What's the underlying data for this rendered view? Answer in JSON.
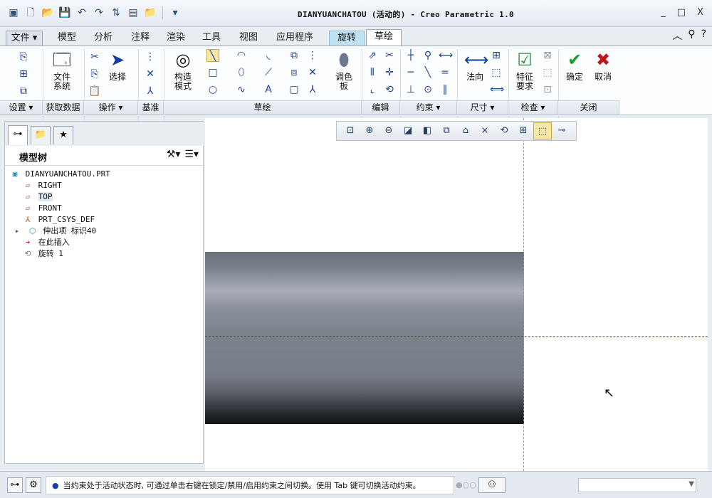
{
  "window": {
    "title": "DIANYUANCHATOU (活动的) - Creo Parametric 1.0",
    "buttons": [
      "_",
      "□",
      "X"
    ]
  },
  "quick_access": [
    "app-logo-icon",
    "new-icon",
    "open-icon",
    "save-icon",
    "undo-icon",
    "redo-icon",
    "regenerate-icon",
    "windows-icon",
    "folder-icon",
    "customize-icon"
  ],
  "tabs": [
    {
      "label": "文件 ▾",
      "kind": "file"
    },
    {
      "label": "模型",
      "kind": "plain"
    },
    {
      "label": "分析",
      "kind": "plain"
    },
    {
      "label": "注释",
      "kind": "plain"
    },
    {
      "label": "渲染",
      "kind": "plain"
    },
    {
      "label": "工具",
      "kind": "plain"
    },
    {
      "label": "视图",
      "kind": "plain"
    },
    {
      "label": "应用程序",
      "kind": "plain"
    },
    {
      "label": "旋转",
      "kind": "rot"
    },
    {
      "label": "草绘",
      "kind": "sk"
    }
  ],
  "ribbon": {
    "big_buttons": {
      "file_system": "文件\n系统",
      "select": "选择",
      "construction_mode": "构造\n模式",
      "palette": "调色\n板",
      "normal": "法向",
      "feature_req": "特征\n要求",
      "ok": "确定",
      "cancel": "取消"
    },
    "groups": [
      {
        "label": "设置 ▾"
      },
      {
        "label": "获取数据"
      },
      {
        "label": "操作 ▾"
      },
      {
        "label": "基准"
      },
      {
        "label": "草绘"
      },
      {
        "label": "编辑"
      },
      {
        "label": "约束 ▾"
      },
      {
        "label": "尺寸 ▾"
      },
      {
        "label": "检查 ▾"
      },
      {
        "label": "关闭"
      }
    ]
  },
  "model_tree": {
    "header": "模型树",
    "items": [
      {
        "label": "DIANYUANCHATOU.PRT",
        "icon": "part-icon",
        "indent": 0
      },
      {
        "label": "RIGHT",
        "icon": "datum-plane-icon",
        "indent": 1
      },
      {
        "label": "TOP",
        "icon": "datum-plane-icon",
        "indent": 1,
        "selected": true
      },
      {
        "label": "FRONT",
        "icon": "datum-plane-icon",
        "indent": 1
      },
      {
        "label": "PRT_CSYS_DEF",
        "icon": "csys-icon",
        "indent": 1
      },
      {
        "label": "伸出项 标识40",
        "icon": "extrude-icon",
        "indent": 1,
        "expandable": true
      },
      {
        "label": "在此插入",
        "icon": "insert-arrow-icon",
        "indent": 1
      },
      {
        "label": "旋转 1",
        "icon": "revolve-icon",
        "indent": 1
      }
    ]
  },
  "status": {
    "message": "当约束处于活动状态时, 可通过单击右键在锁定/禁用/启用约束之间切换。使用 Tab 键可切换活动约束。",
    "filter_value": ""
  },
  "colors": {
    "accent_tab_rotate": "#bfe2f5",
    "centerline_horizontal": "#1a3ac8",
    "centerline_vertical": "#3cb9c6"
  }
}
